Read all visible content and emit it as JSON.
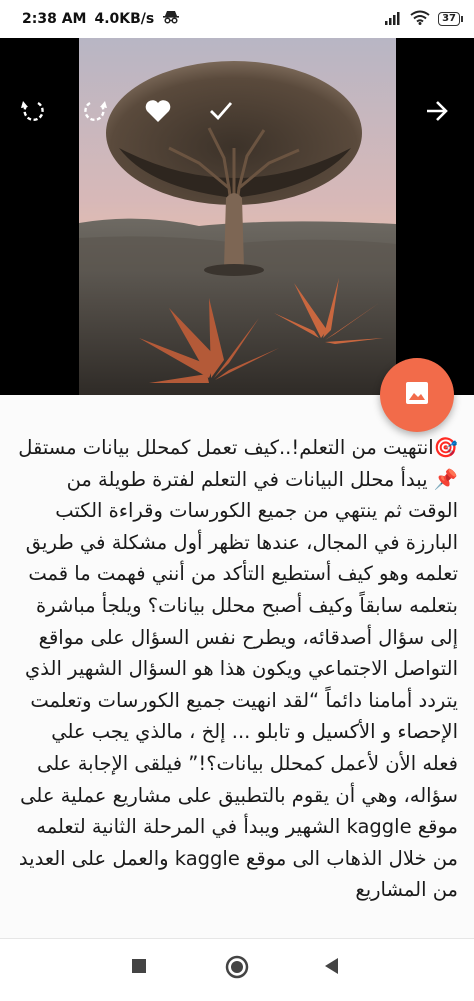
{
  "status_bar": {
    "time": "2:38 AM",
    "network_speed": "4.0KB/s",
    "battery": "37",
    "icons": [
      "incognito-icon",
      "signal-icon",
      "wifi-icon",
      "battery-icon"
    ]
  },
  "toolbar": {
    "icons": [
      "rotate-left-icon",
      "rotate-right-icon",
      "heart-icon",
      "check-icon",
      "arrow-right-icon"
    ]
  },
  "fab": {
    "icon": "image-icon",
    "color": "#f26b4a"
  },
  "caption": {
    "title": "🎯انتهيت من التعلم!..كيف تعمل كمحلل بيانات مستقل",
    "body": "📌 يبدأ محلل البيانات في التعلم لفترة طويلة من الوقت ثم ينتهي من جميع الكورسات وقراءة الكتب البارزة في المجال، عندها تظهر أول مشكلة في طريق تعلمه وهو كيف أستطيع التأكد من أنني فهمت ما قمت بتعلمه سابقاً وكيف أصبح محلل بيانات؟ ويلجأ مباشرة إلى سؤال أصدقائه، ويطرح نفس السؤال على مواقع التواصل الاجتماعي ويكون هذا هو السؤال الشهير الذي يتردد أمامنا دائماً “لقد انهيت جميع الكورسات وتعلمت الإحصاء و الأكسيل و تابلو ... إلخ ، مالذي يجب علي فعله الأن لأعمل كمحلل بيانات؟!” فيلقى الإجابة على سؤاله، وهي أن يقوم بالتطبيق على مشاريع عملية على موقع kaggle الشهير ويبدأ في المرحلة الثانية لتعلمه من خلال الذهاب الى موقع kaggle والعمل على العديد من المشاريع"
  },
  "nav_bar": {
    "icons": [
      "recents-square-icon",
      "home-circle-icon",
      "back-triangle-icon"
    ]
  }
}
